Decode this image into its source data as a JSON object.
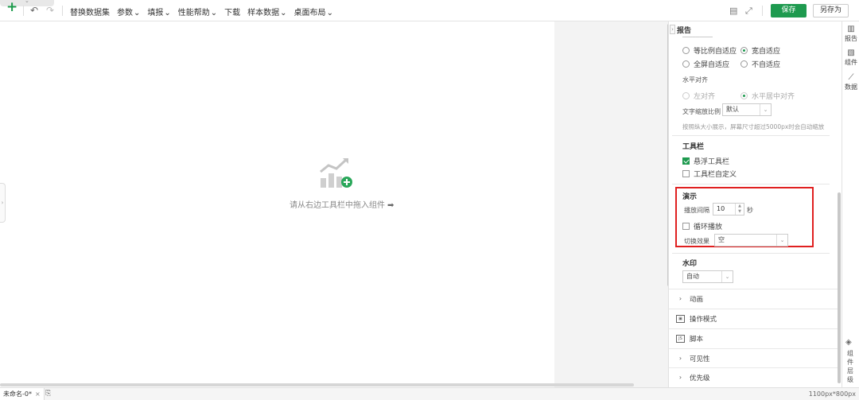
{
  "toolbar": {
    "menus": [
      {
        "label": "替换数据集",
        "caret": false,
        "disabled": false
      },
      {
        "label": "参数",
        "caret": true,
        "disabled": false
      },
      {
        "label": "填报",
        "caret": true,
        "disabled": false
      },
      {
        "label": "性能帮助",
        "caret": true,
        "disabled": false
      },
      {
        "label": "下载",
        "caret": false,
        "disabled": true
      },
      {
        "label": "样本数据",
        "caret": true,
        "disabled": false
      },
      {
        "label": "桌面布局",
        "caret": true,
        "disabled": false
      }
    ],
    "save_label": "保存",
    "save_as_label": "另存为"
  },
  "canvas": {
    "empty_hint": "请从右边工具栏中拖入组件"
  },
  "panel": {
    "title": "报告",
    "scale_options": {
      "opt1": "等比例自适应",
      "opt2": "宽自适应",
      "opt3": "全屏自适应",
      "opt4": "不自适应",
      "selected": "宽自适应"
    },
    "h_align": {
      "title": "水平对齐",
      "opt1": "左对齐",
      "opt2": "水平居中对齐"
    },
    "text_scale": {
      "label": "文字缩放比例",
      "value": "默认"
    },
    "hint": "按照纵大小展示，屏幕尺寸超过5000px时会自动缩放",
    "toolbar_section": {
      "title": "工具栏",
      "floating": "悬浮工具栏",
      "floating_checked": true,
      "custom": "工具栏自定义",
      "custom_checked": false
    },
    "demo_section": {
      "title": "演示",
      "interval_label": "播放间隔",
      "interval_value": "10",
      "interval_unit": "秒",
      "loop_label": "循环播放",
      "loop_checked": false,
      "effect_label": "切换效果",
      "effect_value": "空"
    },
    "watermark": {
      "title": "水印",
      "value": "自动"
    },
    "collapsibles": [
      {
        "label": "动画",
        "icon": "chevron"
      },
      {
        "label": "操作模式",
        "icon": "mode"
      },
      {
        "label": "脚本",
        "icon": "js"
      },
      {
        "label": "可见性",
        "icon": "chevron"
      },
      {
        "label": "优先级",
        "icon": "chevron"
      }
    ]
  },
  "rightbar": {
    "items": [
      {
        "label": "报告",
        "icon": "report-icon"
      },
      {
        "label": "组件",
        "icon": "widget-icon"
      },
      {
        "label": "数据",
        "icon": "data-icon"
      }
    ],
    "layers_label": "组件层级"
  },
  "status": {
    "doc_tab": "未命名-0*",
    "canvas_size": "1100px*800px"
  },
  "colors": {
    "accent": "#1e9a4f",
    "highlight": "#e02020"
  }
}
